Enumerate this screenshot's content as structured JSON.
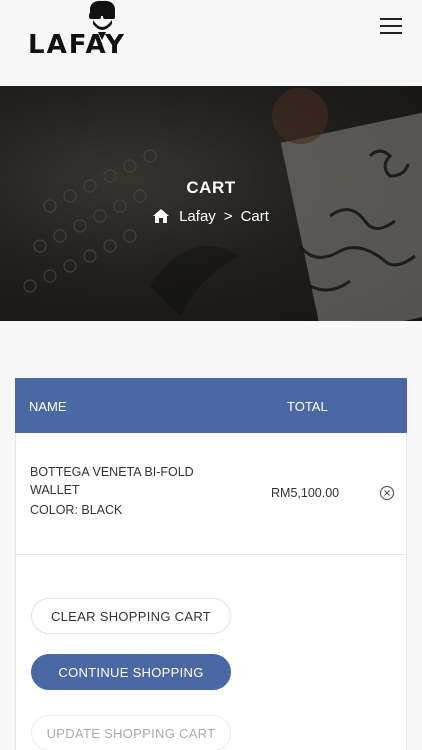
{
  "header": {
    "logo_text": "LAFAY",
    "menu_icon": "hamburger-menu-icon"
  },
  "hero": {
    "title": "CART",
    "breadcrumb": {
      "home_icon": "home-icon",
      "home_label": "Lafay",
      "separator": ">",
      "current": "Cart"
    }
  },
  "cart": {
    "columns": {
      "name": "NAME",
      "total": "TOTAL"
    },
    "items": [
      {
        "name": "BOTTEGA VENETA BI-FOLD WALLET",
        "color": "COLOR: BLACK",
        "total": "RM5,100.00",
        "remove_icon": "remove-circle-icon"
      }
    ]
  },
  "actions": {
    "clear_label": "CLEAR SHOPPING CART",
    "continue_label": "CONTINUE SHOPPING",
    "update_label": "UPDATE SHOPPING CART"
  },
  "colors": {
    "accent": "#4a68a4",
    "background": "#f7f7f7"
  }
}
